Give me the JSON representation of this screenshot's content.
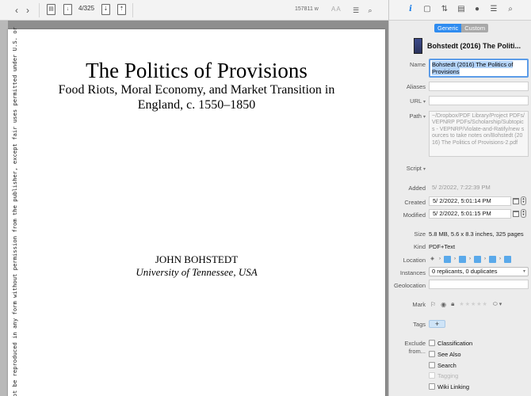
{
  "toolbar": {
    "back": "‹",
    "forward": "›",
    "page_indicator": "4/325",
    "word_count": "157811 w",
    "text_size_glyphs": "AA"
  },
  "document": {
    "title": "The Politics of Provisions",
    "subtitle_line1": "Food Riots, Moral Economy, and Market Transition in",
    "subtitle_line2": "England, c. 1550–1850",
    "author": "JOHN BOHSTEDT",
    "affiliation": "University of Tennessee, USA",
    "vertical_notice": "May not be reproduced in any form without permission from the publisher, except fair uses permitted under U.S. or"
  },
  "inspector": {
    "segments": [
      "Generic",
      "Custom"
    ],
    "header_title": "Bohstedt (2016) The Politi...",
    "labels": {
      "name": "Name",
      "aliases": "Aliases",
      "url": "URL",
      "path": "Path",
      "script": "Script",
      "added": "Added",
      "created": "Created",
      "modified": "Modified",
      "size": "Size",
      "kind": "Kind",
      "location": "Location",
      "instances": "Instances",
      "geolocation": "Geolocation",
      "mark": "Mark",
      "tags": "Tags",
      "exclude_from": "Exclude from..."
    },
    "name_value": "Bohstedt (2016) The Politics of Provisions",
    "aliases_value": "",
    "url_value": "",
    "path_value": "~/Dropbox/PDF Library/Project PDFs/VEPNRP PDFs/Scholarship/Subtopics - VEPNRP/Violate-and-Ratify/new sources to take notes on/Bohstedt (2016) The Politics of Provisions-2.pdf",
    "added_value": "5/  2/2022,   7:22:39 PM",
    "created_value": "5/  2/2022,   5:01:14 PM",
    "modified_value": "5/  2/2022,   5:01:15 PM",
    "size_value": "5.8 MB, 5.6 x 8.3 inches, 325 pages",
    "kind_value": "PDF+Text",
    "instances_value": "0 replicants, 0 duplicates",
    "tags_add": "+",
    "exclude": {
      "classification": "Classification",
      "see_also": "See Also",
      "search": "Search",
      "tagging": "Tagging",
      "wiki_linking": "Wiki Linking"
    }
  },
  "colors": {
    "accent": "#2f8cf0",
    "selection": "#b5d5fb",
    "folder": "#5aa9ea"
  },
  "icons": [
    "chevron-left-icon",
    "chevron-right-icon",
    "document-icon",
    "info-icon",
    "comment-icon",
    "search-icon",
    "calendar-icon",
    "stepper-icon",
    "flag-icon",
    "lock-icon",
    "star-icon"
  ]
}
